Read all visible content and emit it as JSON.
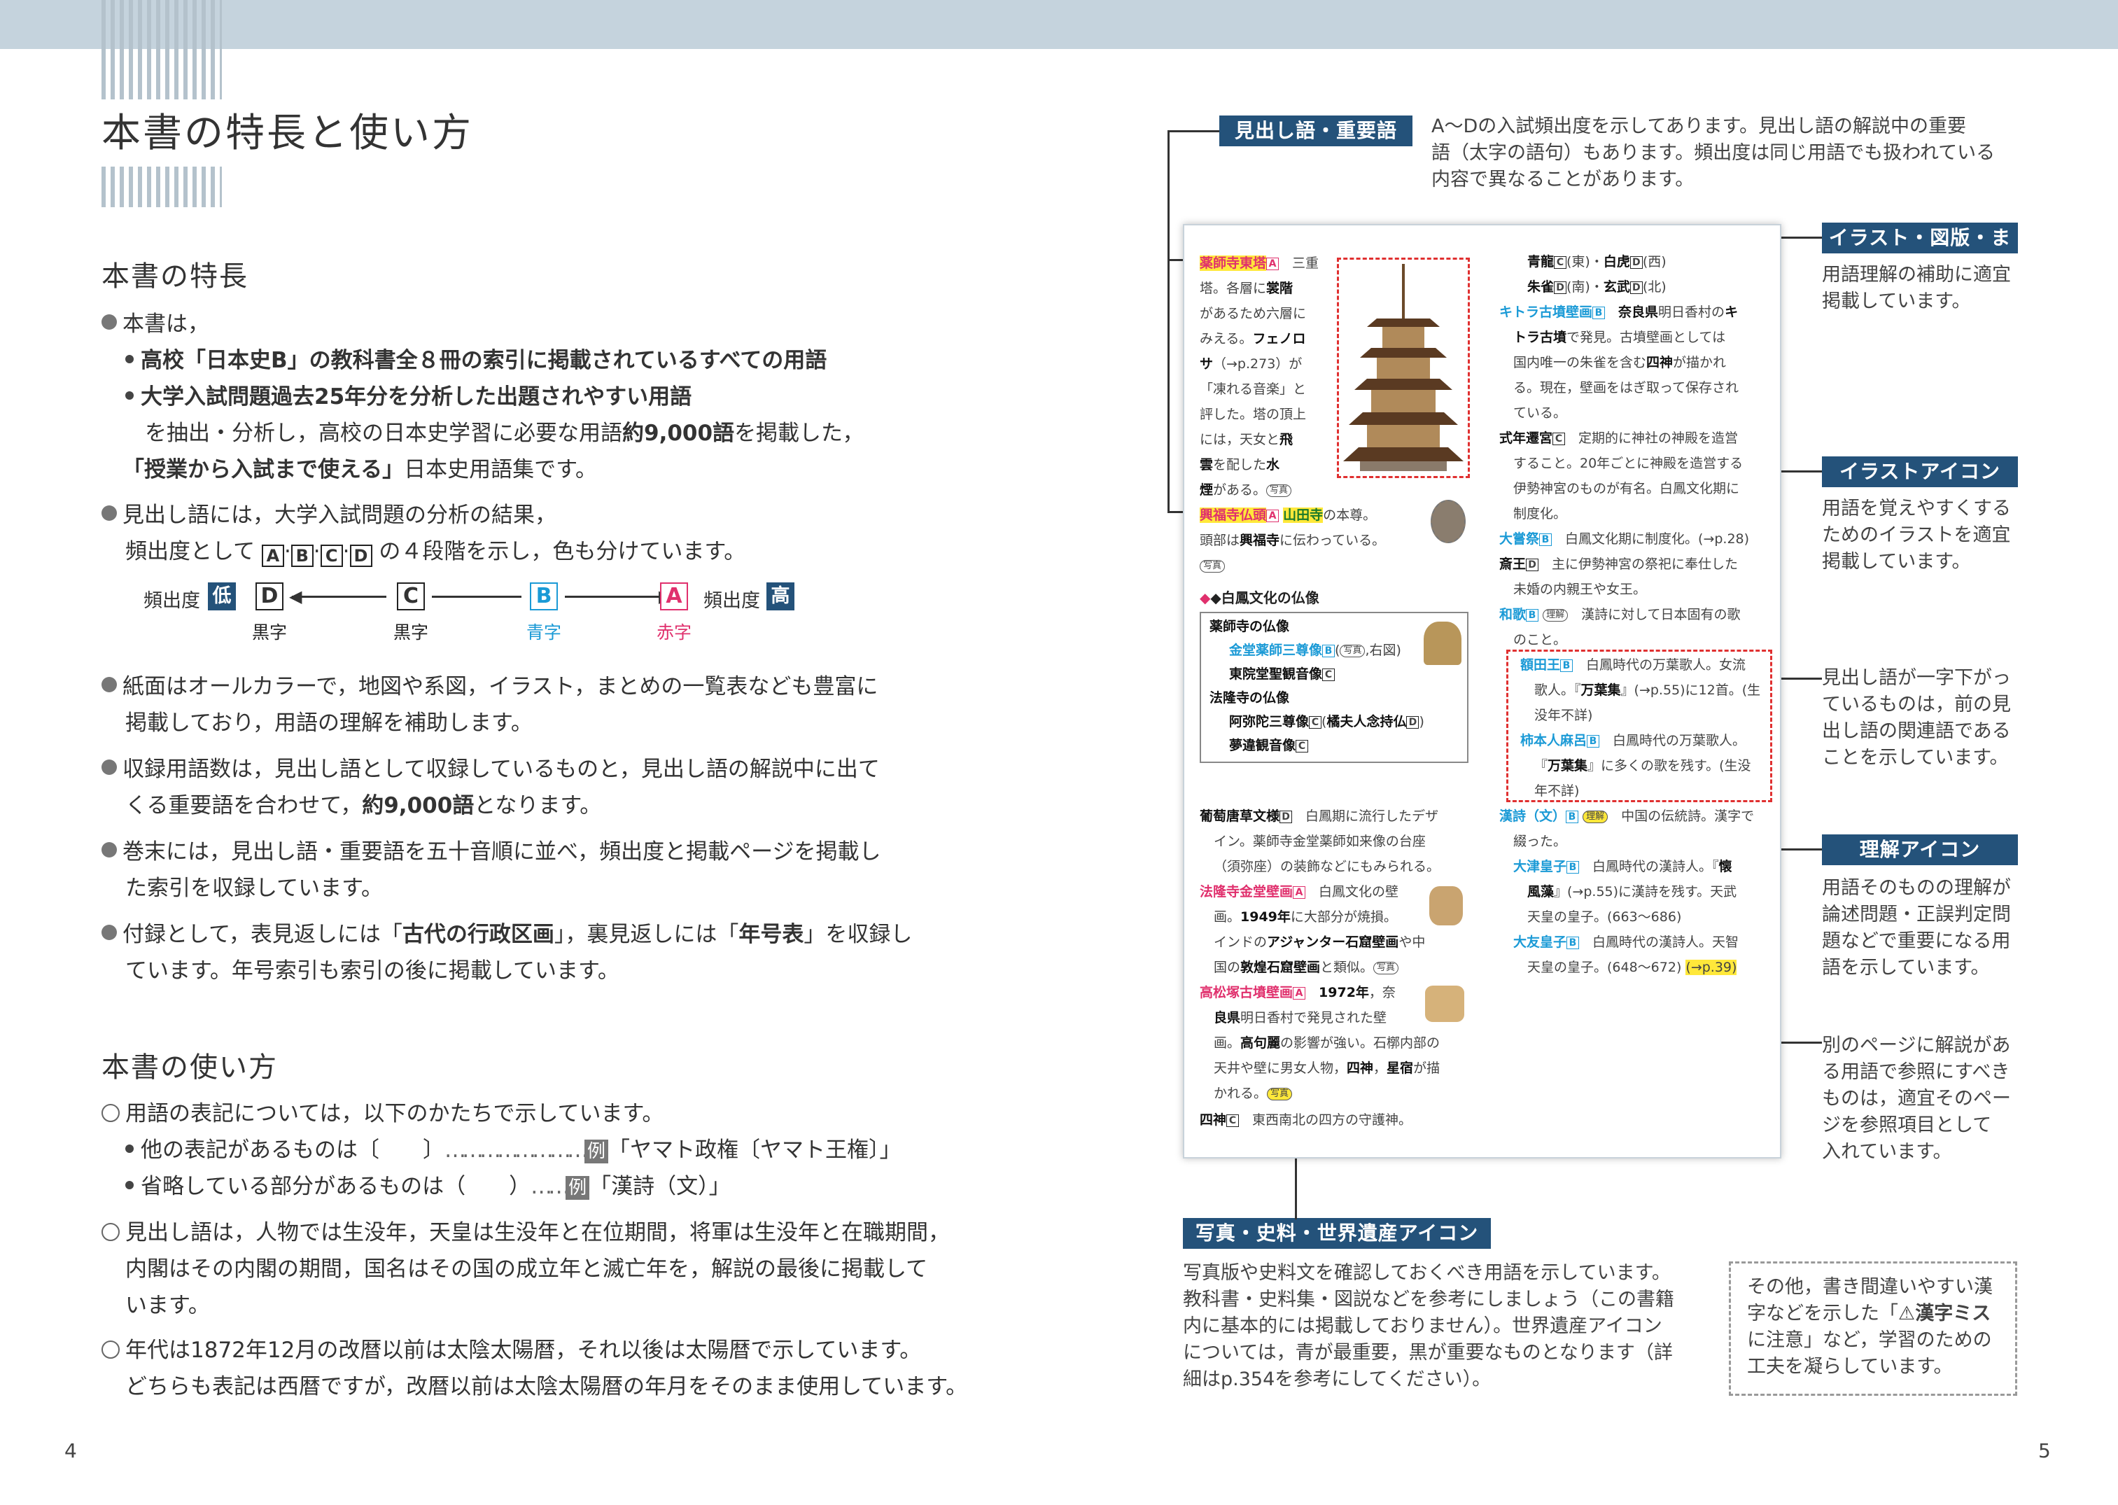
{
  "left": {
    "title": "本書の特長と使い方",
    "features_heading": "本書の特長",
    "f1_intro": "本書は，",
    "f1_sub1": "高校「日本史B」の教科書全８冊の索引に掲載されているすべての用語",
    "f1_sub2a": "大学入試問題過去25年分を分析した出題されやすい用語",
    "f1_sub2b_pre": "を抽出・分析し，高校の日本史学習に必要な用語",
    "f1_sub2b_bold": "約9,000語",
    "f1_sub2b_post": "を掲載した，",
    "f1_sub3_bold": "「授業から入試まで使える」",
    "f1_sub3_post": "日本史用語集です。",
    "f2_line1": "見出し語には，大学入試問題の分析の結果，",
    "f2_line2_pre": "頻出度として",
    "f2_line2_post": "の４段階を示し，色も分けています。",
    "freq_label_left": "頻出度",
    "freq_low": "低",
    "freq_label_right": "頻出度",
    "freq_high": "高",
    "levels": [
      {
        "letter": "D",
        "color_name": "黒字",
        "color": "#222222"
      },
      {
        "letter": "C",
        "color_name": "黒字",
        "color": "#222222"
      },
      {
        "letter": "B",
        "color_name": "青字",
        "color": "#1b9ad6"
      },
      {
        "letter": "A",
        "color_name": "赤字",
        "color": "#e0306d"
      }
    ],
    "f3_line1": "紙面はオールカラーで，地図や系図，イラスト，まとめの一覧表なども豊富に",
    "f3_line2": "掲載しており，用語の理解を補助します。",
    "f4_line1": "収録用語数は，見出し語として収録しているものと，見出し語の解説中に出て",
    "f4_line2_pre": "くる重要語を合わせて，",
    "f4_line2_bold": "約9,000語",
    "f4_line2_post": "となります。",
    "f5_line1": "巻末には，見出し語・重要語を五十音順に並べ，頻出度と掲載ページを掲載し",
    "f5_line2": "た索引を収録しています。",
    "f6_line1_a": "付録として，表見返しには「",
    "f6_line1_b": "古代の行政区画",
    "f6_line1_c": "」，裏見返しには「",
    "f6_line1_d": "年号表",
    "f6_line1_e": "」を収録し",
    "f6_line2": "ています。年号索引も索引の後に掲載しています。",
    "usage_heading": "本書の使い方",
    "u1_line1": "用語の表記については，以下のかたちで示しています。",
    "u1_sub1_pre": "他の表記があるものは〔　　〕",
    "u1_sub1_dots": "……………………",
    "u1_ex": "例",
    "u1_sub1_post": "「ヤマト政権〔ヤマト王権〕」",
    "u1_sub2_pre": "省略している部分があるものは（　　）",
    "u1_sub2_dots": "……",
    "u1_sub2_post": "「漢詩（文）」",
    "u2_line1": "見出し語は，人物では生没年，天皇は生没年と在位期間，将軍は生没年と在職期間，",
    "u2_line2": "内閣はその内閣の期間，国名はその国の成立年と滅亡年を，解説の最後に掲載して",
    "u2_line3": "います。",
    "u3_line1": "年代は1872年12月の改暦以前は太陰太陽暦，それ以後は太陽暦で示しています。",
    "u3_line2": "どちらも表記は西暦ですが，改暦以前は太陰太陽暦の年月をそのまま使用しています。",
    "page_number": "4"
  },
  "right": {
    "tag_midashi": "見出し語・重要語",
    "txt_midashi": [
      "A～Dの入試頻出度を示してあります。見出し語の解説中の重要",
      "語（太字の語句）もあります。頻出度は同じ用語でも扱われている",
      "内容で異なることがあります。"
    ],
    "tag_illust": "イラスト・図版・まとめ",
    "txt_illust": [
      "用語理解の補助に適宜",
      "掲載しています。"
    ],
    "tag_icon": "イラストアイコン",
    "txt_icon": [
      "用語を覚えやすくする",
      "ためのイラストを適宜",
      "掲載しています。"
    ],
    "txt_related": [
      "見出し語が一字下がっ",
      "ているものは，前の見",
      "出し語の関連語である",
      "ことを示しています。"
    ],
    "tag_rikai": "理解アイコン",
    "txt_rikai": [
      "用語そのものの理解が",
      "論述問題・正誤判定問",
      "題などで重要になる用",
      "語を示しています。"
    ],
    "txt_ref": [
      "別のページに解説があ",
      "る用語で参照にすべき",
      "ものは，適宜そのペー",
      "ジを参照項目として",
      "入れています。"
    ],
    "tag_photo": "写真・史料・世界遺産アイコン",
    "txt_photo": [
      "写真版や史料文を確認しておくべき用語を示しています。",
      "教科書・史料集・図説などを参考にしましょう（この書籍",
      "内に基本的には掲載しておりません）。世界遺産アイコン",
      "については，青が最重要，黒が重要なものとなります（詳",
      "細はp.354を参考にしてください）。"
    ],
    "txt_other": [
      "その他，書き間違いやすい漢",
      "字などを示した「",
      "漢字ミス",
      "に注意」など，学習のための",
      "工夫を凝らしています。"
    ],
    "page_number": "5"
  },
  "sample": {
    "l1": "三重",
    "l2": "塔。各層に",
    "l2b": "裳階",
    "l3": "があるため六層に",
    "l4a": "みえる。",
    "l4b": "フェノロ",
    "l5a": "サ",
    "l5b": "（→p.273）が",
    "l6": "「凍れる音楽」と",
    "l7": "評した。塔の頂上",
    "l8a": "には，天女と",
    "l8b": "飛",
    "l9a": "雲",
    "l9b": "を配した",
    "l9c": "水",
    "l10a": "煙",
    "l10b": "がある。",
    "hw1": "薬師寺東塔",
    "hw2": "興福寺仏頭",
    "hw2b": "山田寺",
    "hw2c": "の本尊。",
    "hw2_l2a": "頭部は",
    "hw2_l2b": "興福寺",
    "hw2_l2c": "に伝わっている。",
    "photo": "写真",
    "hakuho": "◆白鳳文化の仏像",
    "box_l1": "薬師寺の仏像",
    "box_l2": "金堂薬師三尊像",
    "box_l2b": "右図",
    "box_l3": "東院堂聖観音像",
    "box_l4": "法隆寺の仏像",
    "box_l5": "阿弥陀三尊像",
    "box_l5b": "橘夫人念持仏",
    "box_l6": "夢違観音像",
    "e1_hw": "葡萄唐草文様",
    "e1_t1": "白鳳期に流行したデザ",
    "e1_t2": "イン。薬師寺金堂薬師如来像の台座",
    "e1_t3": "（須弥座）の装飾などにもみられる。",
    "e2_hw": "法隆寺金堂壁画",
    "e2_t1": "白鳳文化の壁",
    "e2_t2a": "画。",
    "e2_t2b": "1949年",
    "e2_t2c": "に大部分が焼損。",
    "e2_t3a": "インドの",
    "e2_t3b": "アジャンター石窟壁画",
    "e2_t3c": "や中",
    "e2_t4a": "国の",
    "e2_t4b": "敦煌石窟壁画",
    "e2_t4c": "と類似。",
    "e3_hw": "高松塚古墳壁画",
    "e3_t1a": "1972年",
    "e3_t1b": "，奈",
    "e3_t2a": "良県",
    "e3_t2b": "明日香村で発見された壁",
    "e3_t3a": "画。",
    "e3_t3b": "高句麗",
    "e3_t3c": "の影響が強い。石槨内部の",
    "e3_t4a": "天井や壁に男女人物，",
    "e3_t4b": "四神",
    "e3_t4c": "，",
    "e3_t4d": "星宿",
    "e3_t4e": "が描",
    "e3_t5": "かれる。",
    "e4_hw": "四神",
    "e4_t": "東西南北の四方の守護神。",
    "r1a": "青龍",
    "r1b": "(東)・",
    "r1c": "白虎",
    "r1d": "(西)",
    "r2a": "朱雀",
    "r2b": "(南)・",
    "r2c": "玄武",
    "r2d": "(北)",
    "r3_hw": "キトラ古墳壁画",
    "r3_t1a": "奈良県",
    "r3_t1b": "明日香村の",
    "r3_t1c": "キ",
    "r3_t2a": "トラ古墳",
    "r3_t2b": "で発見。古墳壁画としては",
    "r3_t3a": "国内唯一の朱雀を含む",
    "r3_t3b": "四神",
    "r3_t3c": "が描かれ",
    "r3_t4": "る。現在，壁画をはぎ取って保存され",
    "r3_t5": "ている。",
    "r4_hw": "式年遷宮",
    "r4_t1": "定期的に神社の神殿を造営",
    "r4_t2": "すること。20年ごとに神殿を造営する",
    "r4_t3": "伊勢神宮のものが有名。白鳳文化期に",
    "r4_t4": "制度化。",
    "r5_hw": "大嘗祭",
    "r5_t": "白鳳文化期に制度化。(→p.28)",
    "r6_hw": "斎王",
    "r6_t1": "主に伊勢神宮の祭祀に奉仕した",
    "r6_t2": "未婚の内親王や女王。",
    "r7_hw": "和歌",
    "r7_icon": "理解",
    "r7_t1": "漢詩に対して日本固有の歌",
    "r7_t2": "のこと。",
    "r8_hw": "額田王",
    "r8_t1": "白鳳時代の万葉歌人。女流",
    "r8_t2a": "歌人。『",
    "r8_t2b": "万葉集",
    "r8_t2c": "』(→p.55)に12首。(生",
    "r8_t3": "没年不詳)",
    "r9_hw": "柿本人麻呂",
    "r9_t1": "白鳳時代の万葉歌人。",
    "r9_t2a": "『",
    "r9_t2b": "万葉集",
    "r9_t2c": "』に多くの歌を残す。(生没",
    "r9_t3": "年不詳)",
    "r10_hw": "漢詩（文）",
    "r10_icon": "理解",
    "r10_t1": "中国の伝統詩。漢字で",
    "r10_t2": "綴った。",
    "r11_hw": "大津皇子",
    "r11_t1a": "白鳳時代の漢詩人。『",
    "r11_t1b": "懐",
    "r11_t2a": "風藻",
    "r11_t2b": "』(→p.55)に漢詩を残す。天武",
    "r11_t3": "天皇の皇子。(663～686)",
    "r12_hw": "大友皇子",
    "r12_t1": "白鳳時代の漢詩人。天智",
    "r12_t2": "天皇の皇子。(648～672)",
    "r12_ref": "(→p.39)"
  },
  "colors": {
    "accent_navy": "#24527a",
    "pink": "#e0306d",
    "blue": "#1b9ad6",
    "highlight": "#ffe83a",
    "topbar": "#c5d3dd"
  }
}
